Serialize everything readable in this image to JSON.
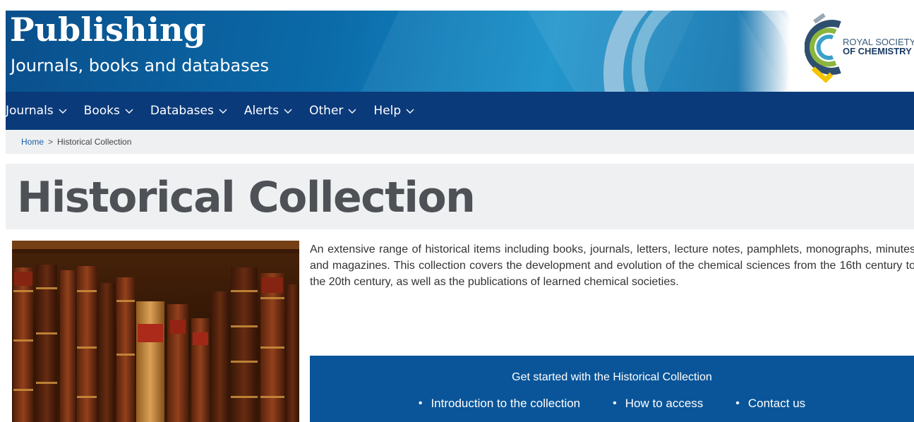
{
  "header": {
    "title": "Publishing",
    "subtitle": "Journals, books and databases",
    "logo": {
      "line1": "ROYAL SOCIETY",
      "line2": "OF CHEMISTRY"
    }
  },
  "nav": {
    "items": [
      {
        "label": "Journals"
      },
      {
        "label": "Books"
      },
      {
        "label": "Databases"
      },
      {
        "label": "Alerts"
      },
      {
        "label": "Other"
      },
      {
        "label": "Help"
      }
    ]
  },
  "breadcrumb": {
    "home": "Home",
    "separator": ">",
    "current": "Historical Collection"
  },
  "page": {
    "title": "Historical Collection",
    "description": "An extensive range of historical items including books, journals, letters, lecture notes, pamphlets, monographs, minutes and magazines. This collection covers the development and evolution of the chemical sciences from the 16th century to the 20th century, as well as the publications of learned chemical societies."
  },
  "get_started": {
    "title": "Get started with the Historical Collection",
    "links": [
      {
        "label": "Introduction to the collection"
      },
      {
        "label": "How to access"
      },
      {
        "label": "Contact us"
      }
    ]
  },
  "colors": {
    "nav_bg": "#0a3a7a",
    "banner_blue": "#0b6aa8",
    "panel_blue": "#0a5599",
    "title_grey": "#4e5256"
  }
}
